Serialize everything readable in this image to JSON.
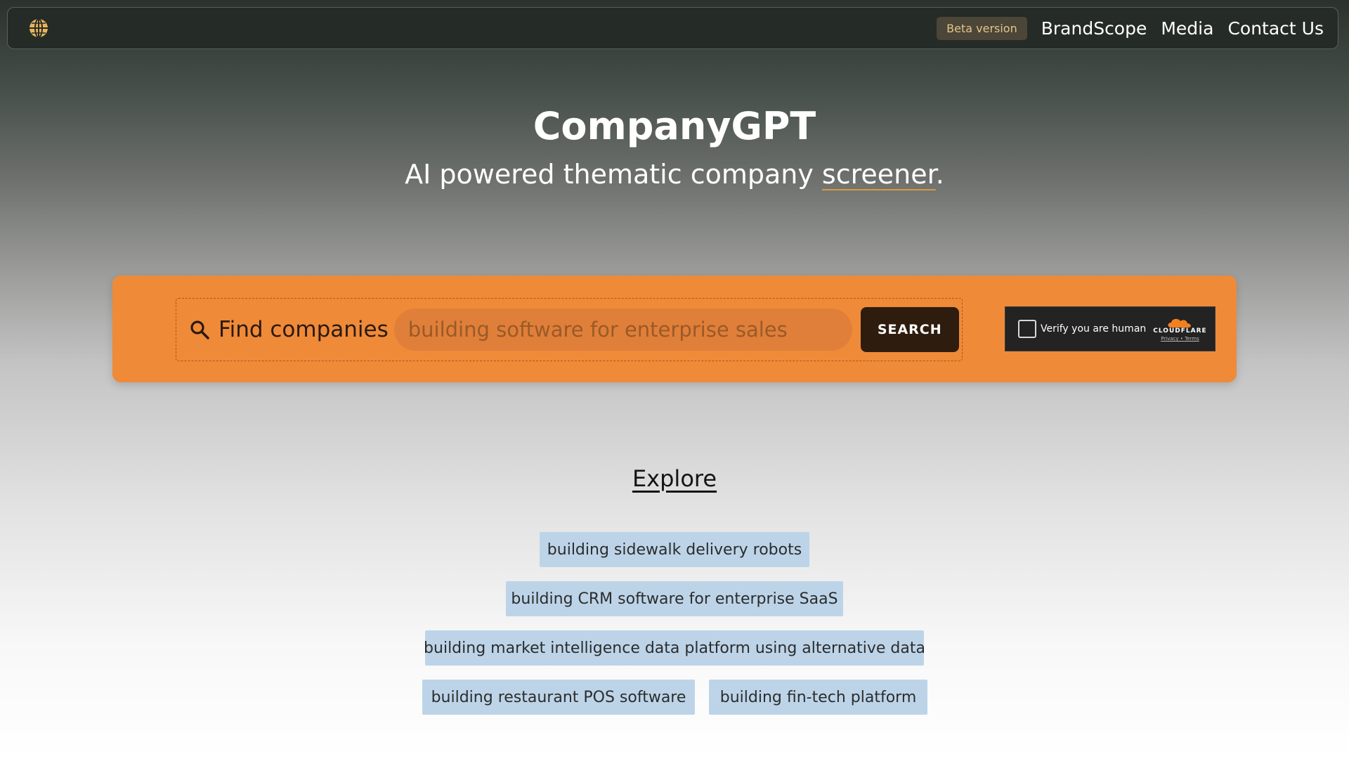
{
  "nav": {
    "logo_icon": "globe-icon",
    "beta_label": "Beta version",
    "links": [
      "BrandScope",
      "Media",
      "Contact Us"
    ]
  },
  "hero": {
    "title": "CompanyGPT",
    "subtitle_before": "AI powered thematic company ",
    "subtitle_underlined": "screener",
    "subtitle_after": "."
  },
  "search": {
    "label": "Find companies",
    "placeholder": "building software for enterprise sales",
    "button_label": "SEARCH"
  },
  "captcha": {
    "text": "Verify you are human",
    "brand": "CLOUDFLARE",
    "links": "Privacy  •  Terms"
  },
  "explore": {
    "title": "Explore",
    "items": [
      "building sidewalk delivery robots",
      "building CRM software for enterprise SaaS",
      "building market intelligence data platform using alternative data",
      "building restaurant POS software",
      "building fin-tech platform"
    ]
  },
  "colors": {
    "accent_orange": "#ef8a39",
    "search_button": "#2e1c0f",
    "chip_blue": "#bdd4e8",
    "navbar": "#252b27"
  }
}
